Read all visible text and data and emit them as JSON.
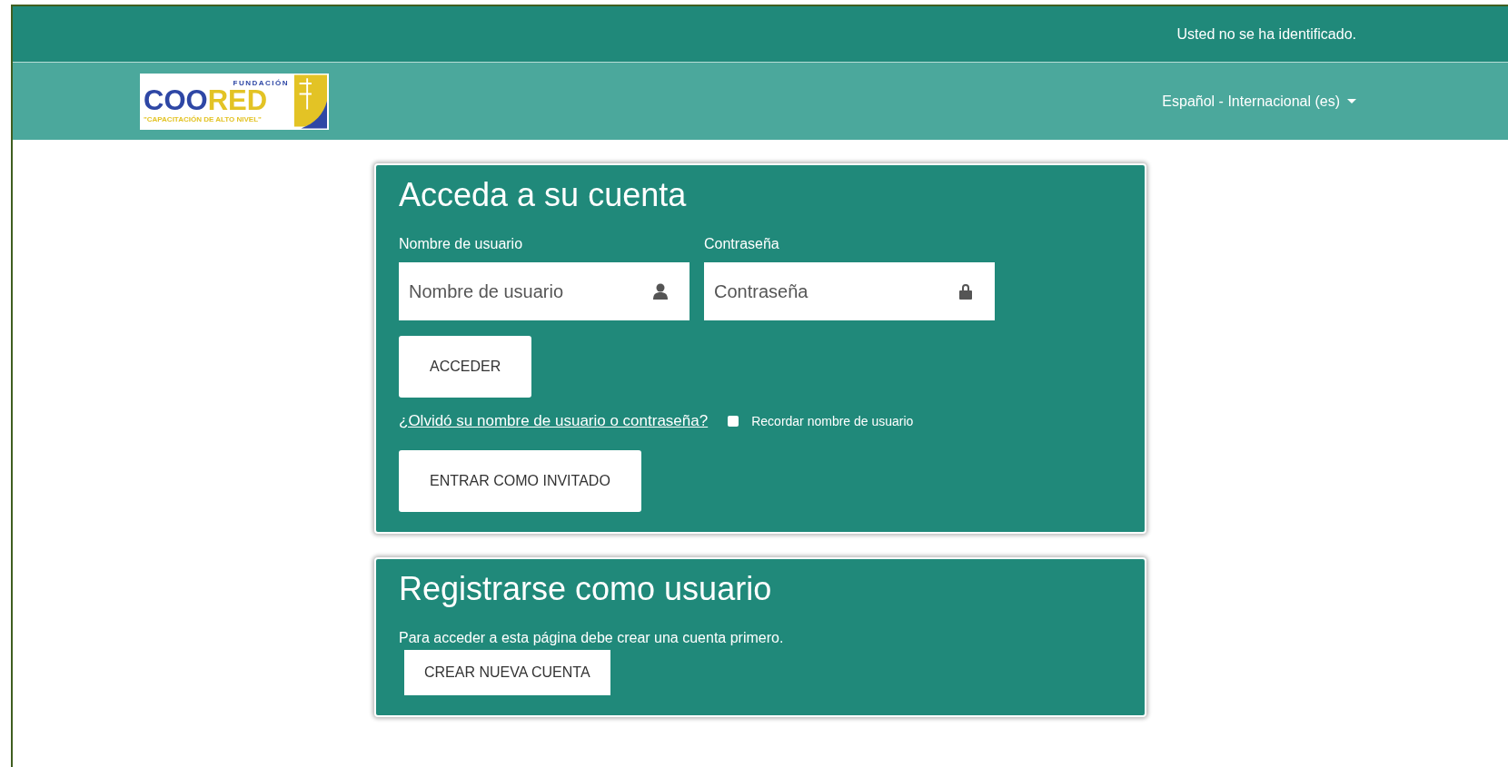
{
  "top_bar": {
    "login_status": "Usted no se ha identificado."
  },
  "navbar": {
    "logo": {
      "top": "FUNDACIÓN",
      "left": "COO",
      "right": "RED",
      "tagline": "\"CAPACITACIÓN DE ALTO NIVEL\""
    },
    "language": "Español - Internacional (es)"
  },
  "login": {
    "title": "Acceda a su cuenta",
    "fields": [
      {
        "label": "Nombre de usuario",
        "placeholder": "Nombre de usuario",
        "kind": "user"
      },
      {
        "label": "Contraseña",
        "placeholder": "Contraseña",
        "kind": "password"
      }
    ],
    "submit": "ACCEDER",
    "forgot_link": "¿Olvidó su nombre de usuario o contraseña?",
    "remember": {
      "label": "Recordar nombre de usuario",
      "checked": false
    },
    "guest_button": "ENTRAR COMO INVITADO"
  },
  "signup": {
    "title": "Registrarse como usuario",
    "text": "Para acceder a esta página debe crear una cuenta primero.",
    "button": "CREAR NUEVA CUENTA"
  }
}
